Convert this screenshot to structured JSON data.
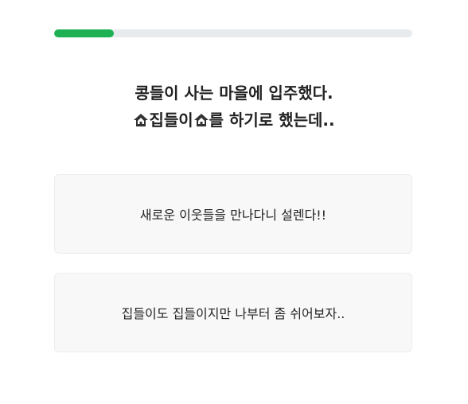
{
  "progress": {
    "fraction": 0.167
  },
  "question": {
    "line1": "콩들이 사는 마을에 입주했다.",
    "line2_part1": "집들이",
    "line2_part2": "를 하기로 했는데..",
    "icon": "house-icon"
  },
  "answers": [
    {
      "label": "새로운 이웃들을 만나다니 설렌다!!"
    },
    {
      "label": "집들이도 집들이지만 나부터 좀 쉬어보자.."
    }
  ],
  "colors": {
    "accent": "#1db154",
    "track": "#e8ebee",
    "card_bg": "#f8f8f8",
    "card_border": "#ececec",
    "text": "#222222"
  }
}
